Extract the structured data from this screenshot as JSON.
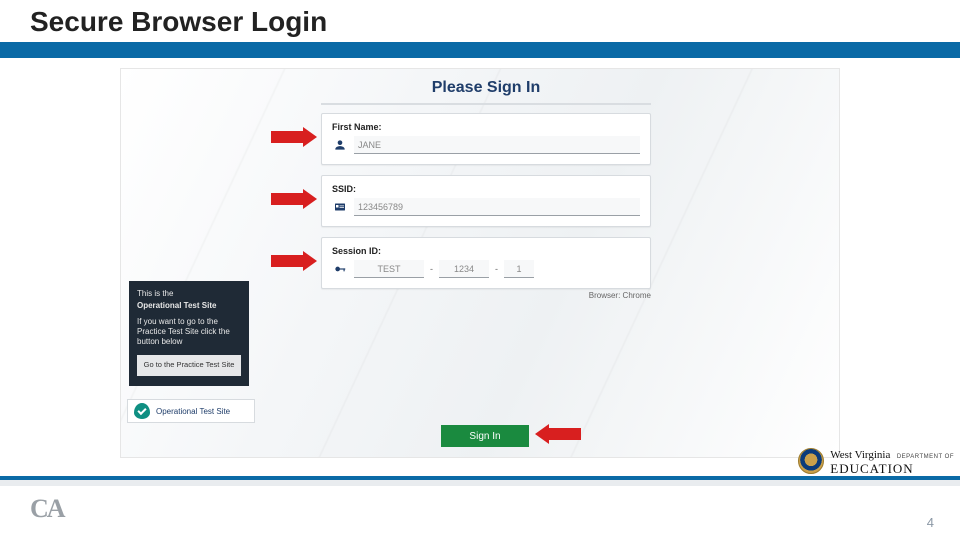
{
  "title": "Secure Browser Login",
  "signin": {
    "heading": "Please Sign In",
    "first_name_label": "First Name:",
    "first_name_value": "JANE",
    "ssid_label": "SSID:",
    "ssid_value": "123456789",
    "session_label": "Session ID:",
    "session_seg1": "TEST",
    "session_seg2": "1234",
    "session_seg3": "1",
    "browser_note": "Browser: Chrome",
    "signin_button": "Sign In"
  },
  "side_panel": {
    "line1": "This is the",
    "line2": "Operational Test Site",
    "line3": "If you want to go to the Practice Test Site click the button below",
    "practice_button": "Go to the Practice Test Site"
  },
  "op_badge": "Operational Test Site",
  "footer": {
    "logo": "CA",
    "page_number": "4",
    "wvde_top_a": "West Virginia",
    "wvde_top_b": "DEPARTMENT OF",
    "wvde_bottom": "EDUCATION"
  }
}
